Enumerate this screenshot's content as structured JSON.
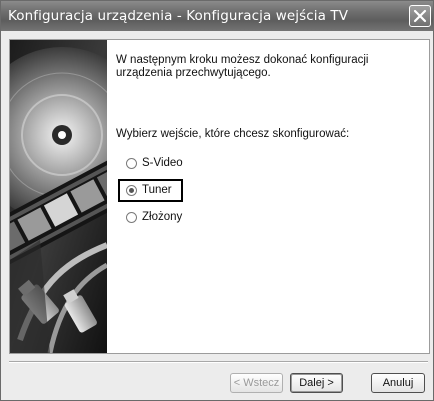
{
  "window": {
    "title": "Konfiguracja urządzenia - Konfiguracja wejścia TV"
  },
  "content": {
    "intro": "W następnym kroku możesz dokonać konfiguracji urządzenia przechwytującego.",
    "prompt": "Wybierz wejście, które chcesz skonfigurować:",
    "options": [
      {
        "label": "S-Video",
        "selected": false
      },
      {
        "label": "Tuner",
        "selected": true
      },
      {
        "label": "Złożony",
        "selected": false
      }
    ]
  },
  "buttons": {
    "back": "< Wstecz",
    "next": "Dalej >",
    "cancel": "Anuluj"
  },
  "icons": {
    "close": "close-icon",
    "radio": "radio-icon"
  },
  "colors": {
    "titlebar": "#6f6f6f",
    "highlight_border": "#000000"
  }
}
